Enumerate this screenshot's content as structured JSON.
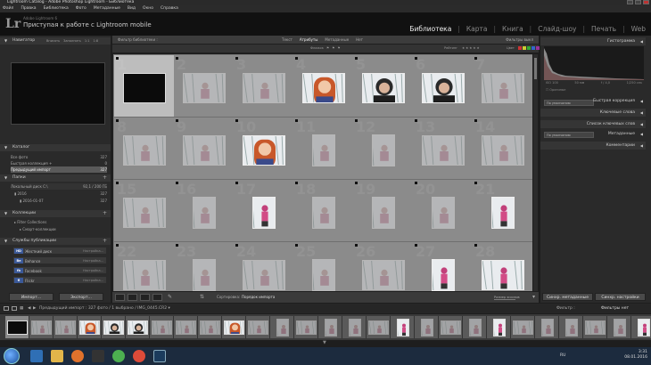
{
  "window": {
    "title": "Lightroom Catalog - Adobe Photoshop Lightroom - Библиотека"
  },
  "menu": [
    "Файл",
    "Правка",
    "Библиотека",
    "Фото",
    "Метаданные",
    "Вид",
    "Окно",
    "Справка"
  ],
  "identity": {
    "sub": "Adobe Lightroom 6",
    "main": "Приступая к работе с Lightroom mobile"
  },
  "modules": [
    {
      "label": "Библиотека",
      "active": true
    },
    {
      "label": "Карта"
    },
    {
      "label": "Книга"
    },
    {
      "label": "Слайд-шоу"
    },
    {
      "label": "Печать"
    },
    {
      "label": "Web"
    }
  ],
  "navigator": {
    "title": "Навигатор",
    "tabs": [
      "Вписать",
      "Заполнить",
      "1:1",
      "1:8"
    ]
  },
  "catalog": {
    "title": "Каталог",
    "items": [
      {
        "label": "Все фото",
        "count": "327"
      },
      {
        "label": "Быстрая коллекция +",
        "count": "0"
      },
      {
        "label": "Предыдущий импорт",
        "count": "327",
        "selected": true
      }
    ]
  },
  "folders": {
    "title": "Папки",
    "disk": "Локальный диск C:\\",
    "disk_space": "92,1 / 200 ГБ",
    "items": [
      {
        "label": "2016",
        "count": "327"
      },
      {
        "label": "2016-01-07",
        "count": "327"
      }
    ]
  },
  "collections": {
    "title": "Коллекции",
    "items": [
      "Filter Collections",
      "Смарт-коллекции"
    ]
  },
  "publish": {
    "title": "Службы публикации",
    "items": [
      {
        "icon": "HD",
        "label": "Жесткий диск",
        "status": "Настройка..."
      },
      {
        "icon": "Be",
        "label": "Behance",
        "status": "Настройка..."
      },
      {
        "icon": "fb",
        "label": "Facebook",
        "status": "Настройка..."
      },
      {
        "icon": "fl",
        "label": "Flickr",
        "status": "Настройка..."
      }
    ]
  },
  "left_buttons": {
    "import": "Импорт...",
    "export": "Экспорт..."
  },
  "filterbar": {
    "title": "Фильтр библиотеки :",
    "tabs": [
      {
        "label": "Текст"
      },
      {
        "label": "Атрибуты",
        "active": true
      },
      {
        "label": "Метаданные"
      },
      {
        "label": "Нет"
      }
    ],
    "right": "Фильтры выкл"
  },
  "attrbar": {
    "flag": "Флажок",
    "rating": "Рейтинг",
    "color": "Цвет",
    "swatch_colors": [
      "#c33",
      "#cc3",
      "#3a3",
      "#36c",
      "#939",
      "#888",
      "#666"
    ]
  },
  "grid": {
    "cols": 7,
    "rows": 4,
    "cells": [
      {
        "idx": "1",
        "selected": true,
        "shape": "land",
        "dark": true
      },
      {
        "idx": "2",
        "shape": "land",
        "dim": true
      },
      {
        "idx": "3",
        "shape": "land",
        "dim": true
      },
      {
        "idx": "4",
        "shape": "land",
        "photo": "woman"
      },
      {
        "idx": "5",
        "shape": "land",
        "photo": "man"
      },
      {
        "idx": "6",
        "shape": "land",
        "photo": "man"
      },
      {
        "idx": "7",
        "shape": "land",
        "dim": true
      },
      {
        "idx": "8",
        "shape": "land",
        "dim": true
      },
      {
        "idx": "9",
        "shape": "land",
        "dim": true
      },
      {
        "idx": "10",
        "shape": "land",
        "photo": "woman"
      },
      {
        "idx": "11",
        "shape": "port",
        "dim": true
      },
      {
        "idx": "12",
        "shape": "port",
        "dim": true
      },
      {
        "idx": "13",
        "shape": "land",
        "dim": true
      },
      {
        "idx": "14",
        "shape": "land",
        "dim": true
      },
      {
        "idx": "15",
        "shape": "land",
        "dim": true
      },
      {
        "idx": "16",
        "shape": "port",
        "dim": true
      },
      {
        "idx": "17",
        "shape": "port",
        "photo": "child"
      },
      {
        "idx": "18",
        "shape": "port",
        "dim": true
      },
      {
        "idx": "19",
        "shape": "port",
        "dim": true
      },
      {
        "idx": "20",
        "shape": "port",
        "dim": true
      },
      {
        "idx": "21",
        "shape": "port",
        "photo": "child"
      },
      {
        "idx": "22",
        "shape": "land",
        "dim": true
      },
      {
        "idx": "23",
        "shape": "port",
        "dim": true
      },
      {
        "idx": "24",
        "shape": "land",
        "dim": true
      },
      {
        "idx": "25",
        "shape": "port",
        "dim": true
      },
      {
        "idx": "26",
        "shape": "land",
        "dim": true
      },
      {
        "idx": "27",
        "shape": "port",
        "photo": "child"
      },
      {
        "idx": "28",
        "shape": "land",
        "photo": "child"
      }
    ]
  },
  "toolbar": {
    "sort_label": "Сортировка:",
    "sort_value": "Порядок импорта",
    "thumbs_label": "Размер эскизов"
  },
  "right": {
    "histogram": "Гистограмма",
    "histo_info": [
      "ISO 100",
      "50 мм",
      "f / 4,0",
      "1/250 сек"
    ],
    "original": "Оригинал",
    "quick_develop": "Быстрая коррекция",
    "keywording": "Ключевые слова",
    "keyword_list": "Список ключевых слов",
    "metadata": "Метаданные",
    "comments": "Комментарии",
    "preset_default": "По умолчанию",
    "preset_default2": "По умолчанию",
    "sync_metadata": "Синхр. метаданные",
    "sync_settings": "Синхр. настройки"
  },
  "filmstrip": {
    "pages": [
      "1",
      "2"
    ],
    "path": "Предыдущий импорт : 327 фото / 1 выбрано / IMG_0445.CR2 ▾",
    "filter_label": "Фильтр :",
    "filter_value": "Фильтры нет"
  },
  "tray": {
    "lang": "RU",
    "time": "3:31",
    "date": "08.01.2016"
  }
}
